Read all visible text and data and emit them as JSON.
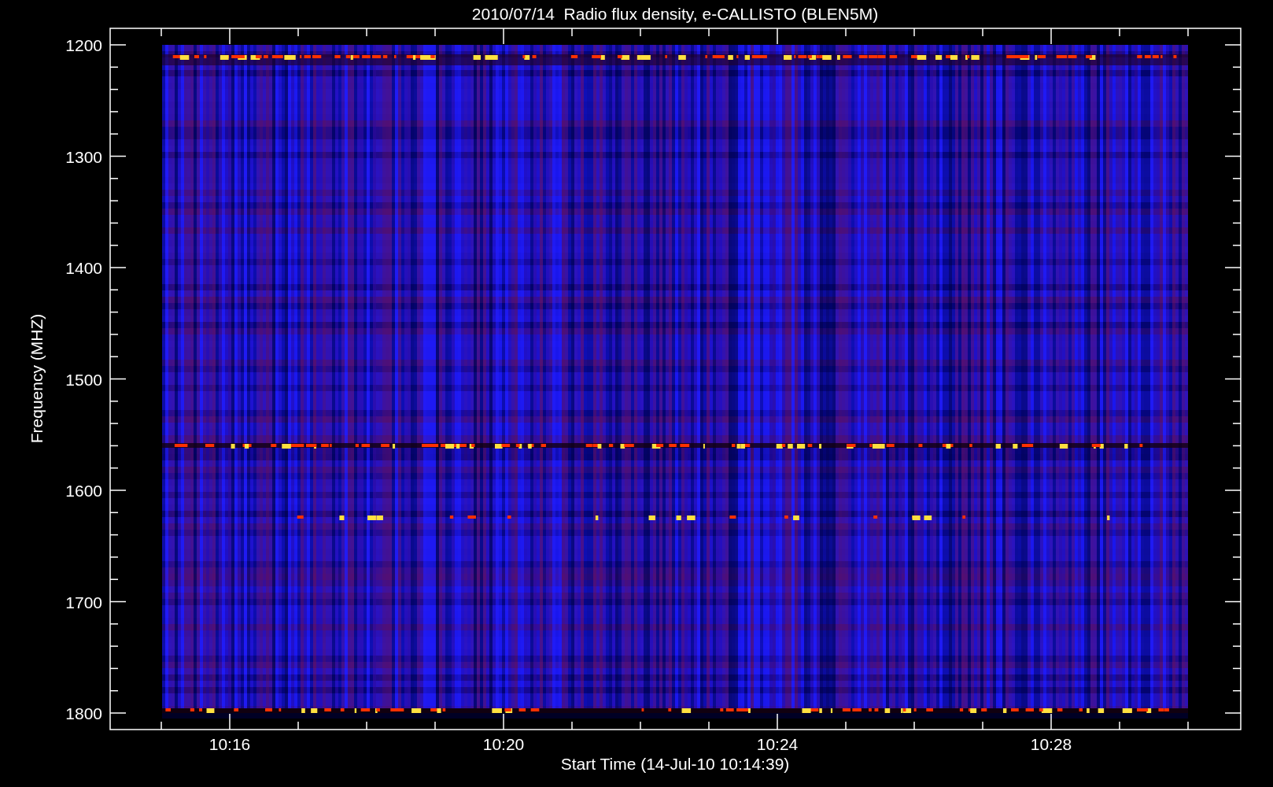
{
  "title": "2010/07/14  Radio flux density, e-CALLISTO (BLEN5M)",
  "y_axis": {
    "label": "Frequency (MHZ)",
    "ticks": [
      "1200",
      "1300",
      "1400",
      "1500",
      "1600",
      "1700",
      "1800"
    ]
  },
  "x_axis": {
    "label": "Start Time (14-Jul-10 10:14:39)",
    "ticks": [
      "10:16",
      "10:20",
      "10:24",
      "10:28"
    ]
  }
}
